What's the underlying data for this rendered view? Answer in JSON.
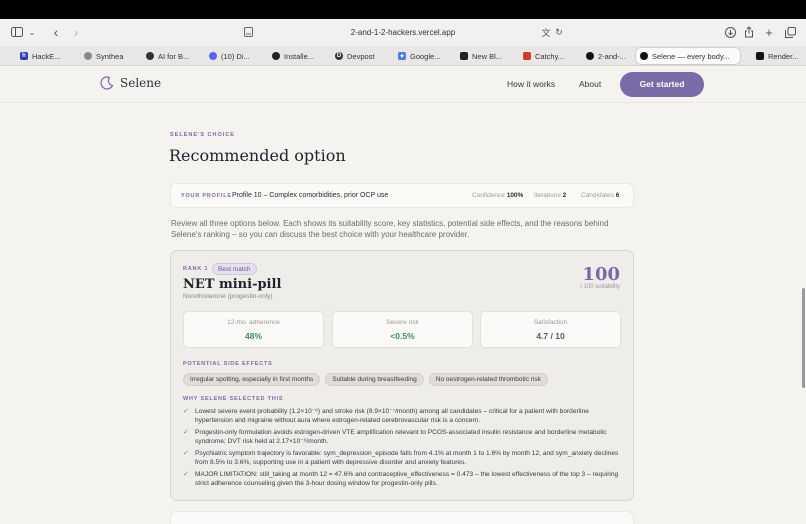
{
  "browser": {
    "url": "2-and-1-2-hackers.vercel.app",
    "tabs": [
      {
        "label": "HackE...",
        "color": "#2a3fb6"
      },
      {
        "label": "Synthea",
        "color": "#8a8a8a"
      },
      {
        "label": "AI for B...",
        "color": "#333333"
      },
      {
        "label": "(10) Di...",
        "color": "#5865f2"
      },
      {
        "label": "Installe...",
        "color": "#222222"
      },
      {
        "label": "Devpost",
        "color": "#333333"
      },
      {
        "label": "Google...",
        "color": "#4a7be0"
      },
      {
        "label": "New Bl...",
        "color": "#222222"
      },
      {
        "label": "Catchy...",
        "color": "#d0392b"
      },
      {
        "label": "2-and-...",
        "color": "#111111"
      },
      {
        "label": "Selene — every body...",
        "color": "#111111"
      },
      {
        "label": "Render...",
        "color": "#111111"
      }
    ]
  },
  "header": {
    "brand": "Selene",
    "nav": [
      "How it works",
      "About"
    ],
    "cta": "Get started"
  },
  "page": {
    "eyebrow": "SELENE'S CHOICE",
    "title": "Recommended option",
    "profile": {
      "label": "YOUR PROFILE",
      "value": "Profile 10 – Complex comorbidities, prior OCP use",
      "confidence_label": "Confidence",
      "confidence": "100%",
      "iterations_label": "Iterations",
      "iterations": "2",
      "candidates_label": "Candidates",
      "candidates": "6"
    },
    "intro": "Review all three options below. Each shows its suitability score, key statistics, potential side effects, and the reasons behind Selene's ranking – so you can discuss the best choice with your healthcare provider.",
    "option": {
      "rank": "RANK 1",
      "badge": "Best match",
      "name": "NET mini-pill",
      "subtitle": "Norethisterone (progestin-only)",
      "score": "100",
      "score_sub": "/ 100 suitability",
      "stats": [
        {
          "label": "12-mo. adherence",
          "value": "48%",
          "color": "#3f8a5e"
        },
        {
          "label": "Severe risk",
          "value": "<0.5%",
          "color": "#3f8a5e"
        },
        {
          "label": "Satisfaction",
          "value": "4.7 / 10",
          "color": "#5a5a66"
        }
      ],
      "side_effects_title": "POTENTIAL SIDE EFFECTS",
      "side_effects": [
        "Irregular spotting, especially in first months",
        "Suitable during breastfeeding",
        "No oestrogen-related thrombotic risk"
      ],
      "reasons_title": "WHY SELENE SELECTED THIS",
      "reasons": [
        "Lowest severe event probability (1.2×10⁻⁶) and stroke risk (8.9×10⁻⁷/month) among all candidates – critical for a patient with borderline hypertension and migraine without aura where estrogen-related cerebrovascular risk is a concern.",
        "Progestin-only formulation avoids estrogen-driven VTE amplification relevant to PCOS-associated insulin resistance and borderline metabolic syndrome; DVT risk held at 2.17×10⁻⁶/month.",
        "Psychiatric symptom trajectory is favorable: sym_depression_episode falls from 4.1% at month 1 to 1.6% by month 12, and sym_anxiety declines from 8.5% to 3.6%, supporting use in a patient with depressive disorder and anxiety features.",
        "MAJOR LIMITATION: still_taking at month 12 = 47.6% and contraceptive_effectiveness = 0.473 – the lowest effectiveness of the top 3 – requiring strict adherence counseling given the 3-hour dosing window for progestin-only pills."
      ]
    }
  }
}
